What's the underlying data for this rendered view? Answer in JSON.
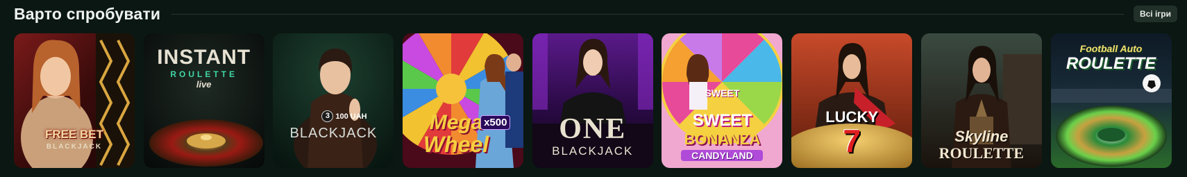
{
  "section": {
    "title": "Варто спробувати",
    "all_games_label": "Всі ігри"
  },
  "games": [
    {
      "line1": "FREE BET",
      "line2": "BLACKJACK"
    },
    {
      "line1": "INSTANT",
      "line2": "ROULETTE",
      "line3": "live"
    },
    {
      "line1": "BLACKJACK",
      "badge_num": "3",
      "badge_text": "100 UAH"
    },
    {
      "line1": "Mega",
      "line2": "Wheel",
      "badge_text": "x500"
    },
    {
      "line1": "ONE",
      "line2": "BLACKJACK"
    },
    {
      "line1": "SWEET",
      "line2": "BONANZA",
      "line3": "CANDYLAND"
    },
    {
      "line1": "LUCKY",
      "line2": "7"
    },
    {
      "line1": "Skyline",
      "line2": "ROULETTE"
    },
    {
      "line1": "Football Auto",
      "line2": "ROULETTE"
    }
  ],
  "colors": {
    "background": "#0b1712",
    "button_bg": "#22302a",
    "divider": "#26352e"
  }
}
